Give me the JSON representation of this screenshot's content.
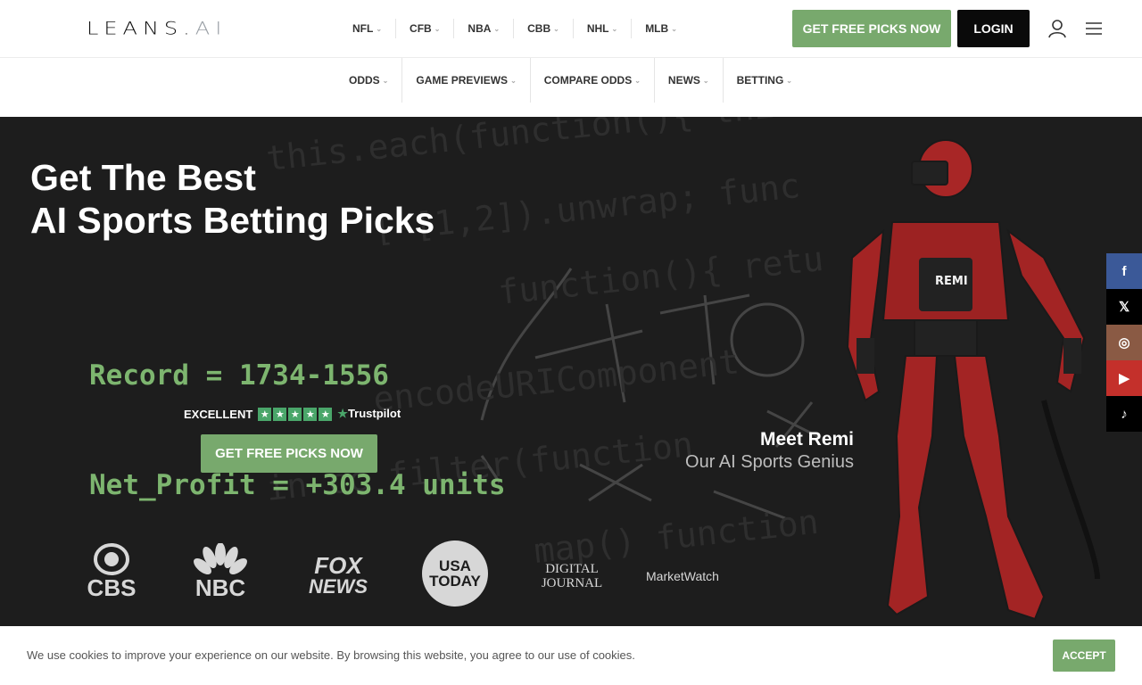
{
  "header": {
    "logo_main": "LEANS.",
    "logo_ai": "AI",
    "top_nav": [
      "NFL",
      "CFB",
      "NBA",
      "CBB",
      "NHL",
      "MLB"
    ],
    "cta_label": "GET FREE PICKS NOW",
    "login_label": "LOGIN"
  },
  "secondary_nav": [
    "ODDS",
    "GAME PREVIEWS",
    "COMPARE ODDS",
    "NEWS",
    "BETTING"
  ],
  "hero": {
    "headline_line1": "Get The Best",
    "headline_line2": "AI Sports Betting Picks",
    "record_line": "Record = 1734-1556",
    "profit_line": "Net_Profit = +303.4 units",
    "trust_label": "EXCELLENT",
    "trust_brand": "Trustpilot",
    "cta_label": "GET FREE PICKS NOW",
    "meet_title": "Meet Remi",
    "meet_subtitle": "Our AI Sports Genius",
    "robot_badge": "REMI"
  },
  "press_logos": {
    "cbs": "CBS",
    "nbc": "NBC",
    "fox_line1": "FOX",
    "fox_line2": "NEWS",
    "usa_line1": "USA",
    "usa_line2": "TODAY",
    "dj_line1": "DIGITAL",
    "dj_line2": "JOURNAL",
    "marketwatch": "MarketWatch"
  },
  "social": {
    "facebook": "f",
    "x": "𝕏",
    "instagram": "◎",
    "youtube": "▶",
    "tiktok": "♪",
    "colors": {
      "facebook": "#3b5998",
      "x": "#000000",
      "instagram": "#8a5a44",
      "youtube": "#c4302b",
      "tiktok": "#000000"
    }
  },
  "cookie": {
    "text": "We use cookies to improve your experience on our website. By browsing this website, you agree to our use of cookies.",
    "accept_label": "ACCEPT"
  },
  "colors": {
    "accent_green": "#78a96d",
    "record_green": "#7db56f"
  }
}
